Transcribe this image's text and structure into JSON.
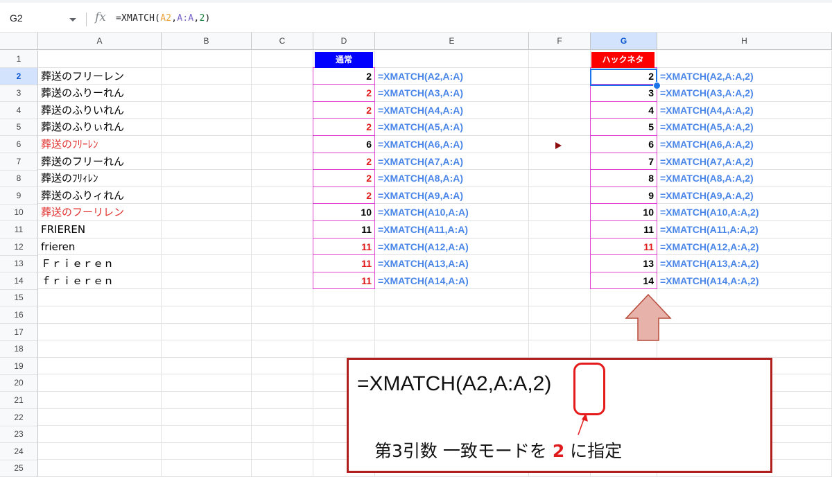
{
  "formula_bar": {
    "name_box": "G2",
    "fx": "fx",
    "formula_pre": "=XMATCH(",
    "formula_ref1": "A2",
    "formula_sep1": ",",
    "formula_ref2": "A:A",
    "formula_sep2": ",",
    "formula_num": "2",
    "formula_post": ")"
  },
  "columns": [
    "A",
    "B",
    "C",
    "D",
    "E",
    "F",
    "G",
    "H"
  ],
  "rows": [
    "1",
    "2",
    "3",
    "4",
    "5",
    "6",
    "7",
    "8",
    "9",
    "10",
    "11",
    "12",
    "13",
    "14",
    "15",
    "16",
    "17",
    "18",
    "19",
    "20",
    "21",
    "22",
    "23",
    "24",
    "25"
  ],
  "selected": {
    "column": "G",
    "row": "2"
  },
  "header_labels": {
    "d1": "通常",
    "g1": "ハックネタ"
  },
  "col_a": [
    {
      "text": "葬送のフリーレン",
      "red": false
    },
    {
      "text": "葬送のふりーれん",
      "red": false
    },
    {
      "text": "葬送のふりいれん",
      "red": false
    },
    {
      "text": "葬送のふりぃれん",
      "red": false
    },
    {
      "text": "葬送のﾌﾘｰﾚﾝ",
      "red": true
    },
    {
      "text": "葬送のフリーれん",
      "red": false
    },
    {
      "text": "葬送のﾌﾘｨﾚﾝ",
      "red": false
    },
    {
      "text": "葬送のふりィれん",
      "red": false
    },
    {
      "text": "葬送のフーリレン",
      "red": true
    },
    {
      "text": "FRIEREN",
      "red": false
    },
    {
      "text": "frieren",
      "red": false
    },
    {
      "text": "Ｆｒｉｅｒｅｎ",
      "red": false
    },
    {
      "text": "ｆｒｉｅｒｅｎ",
      "red": false
    }
  ],
  "col_d": [
    {
      "value": "2",
      "red": false
    },
    {
      "value": "2",
      "red": true
    },
    {
      "value": "2",
      "red": true
    },
    {
      "value": "2",
      "red": true
    },
    {
      "value": "6",
      "red": false
    },
    {
      "value": "2",
      "red": true
    },
    {
      "value": "2",
      "red": true
    },
    {
      "value": "2",
      "red": true
    },
    {
      "value": "10",
      "red": false
    },
    {
      "value": "11",
      "red": false
    },
    {
      "value": "11",
      "red": true
    },
    {
      "value": "11",
      "red": true
    },
    {
      "value": "11",
      "red": true
    }
  ],
  "col_e": [
    "=XMATCH(A2,A:A)",
    "=XMATCH(A3,A:A)",
    "=XMATCH(A4,A:A)",
    "=XMATCH(A5,A:A)",
    "=XMATCH(A6,A:A)",
    "=XMATCH(A7,A:A)",
    "=XMATCH(A8,A:A)",
    "=XMATCH(A9,A:A)",
    "=XMATCH(A10,A:A)",
    "=XMATCH(A11,A:A)",
    "=XMATCH(A12,A:A)",
    "=XMATCH(A13,A:A)",
    "=XMATCH(A14,A:A)"
  ],
  "col_g": [
    {
      "value": "2",
      "red": false
    },
    {
      "value": "3",
      "red": false
    },
    {
      "value": "4",
      "red": false
    },
    {
      "value": "5",
      "red": false
    },
    {
      "value": "6",
      "red": false
    },
    {
      "value": "7",
      "red": false
    },
    {
      "value": "8",
      "red": false
    },
    {
      "value": "9",
      "red": false
    },
    {
      "value": "10",
      "red": false
    },
    {
      "value": "11",
      "red": false
    },
    {
      "value": "11",
      "red": true
    },
    {
      "value": "13",
      "red": false
    },
    {
      "value": "14",
      "red": false
    }
  ],
  "col_h": [
    "=XMATCH(A2,A:A,2)",
    "=XMATCH(A3,A:A,2)",
    "=XMATCH(A4,A:A,2)",
    "=XMATCH(A5,A:A,2)",
    "=XMATCH(A6,A:A,2)",
    "=XMATCH(A7,A:A,2)",
    "=XMATCH(A8,A:A,2)",
    "=XMATCH(A9,A:A,2)",
    "=XMATCH(A10,A:A,2)",
    "=XMATCH(A11,A:A,2)",
    "=XMATCH(A12,A:A,2)",
    "=XMATCH(A13,A:A,2)",
    "=XMATCH(A14,A:A,2)"
  ],
  "callout": {
    "formula_pre": "=XMATCH(A2,A:A,",
    "formula_arg": "2",
    "formula_post": ")",
    "desc_pre": "第3引数 一致モードを ",
    "desc_hi": "2",
    "desc_post": " に指定"
  },
  "colors": {
    "accent": "#1a73e8",
    "formula_blue": "#4a86e8",
    "red": "#e0191b",
    "magenta_border": "#e040d0",
    "callout_border": "#b01e1e"
  }
}
